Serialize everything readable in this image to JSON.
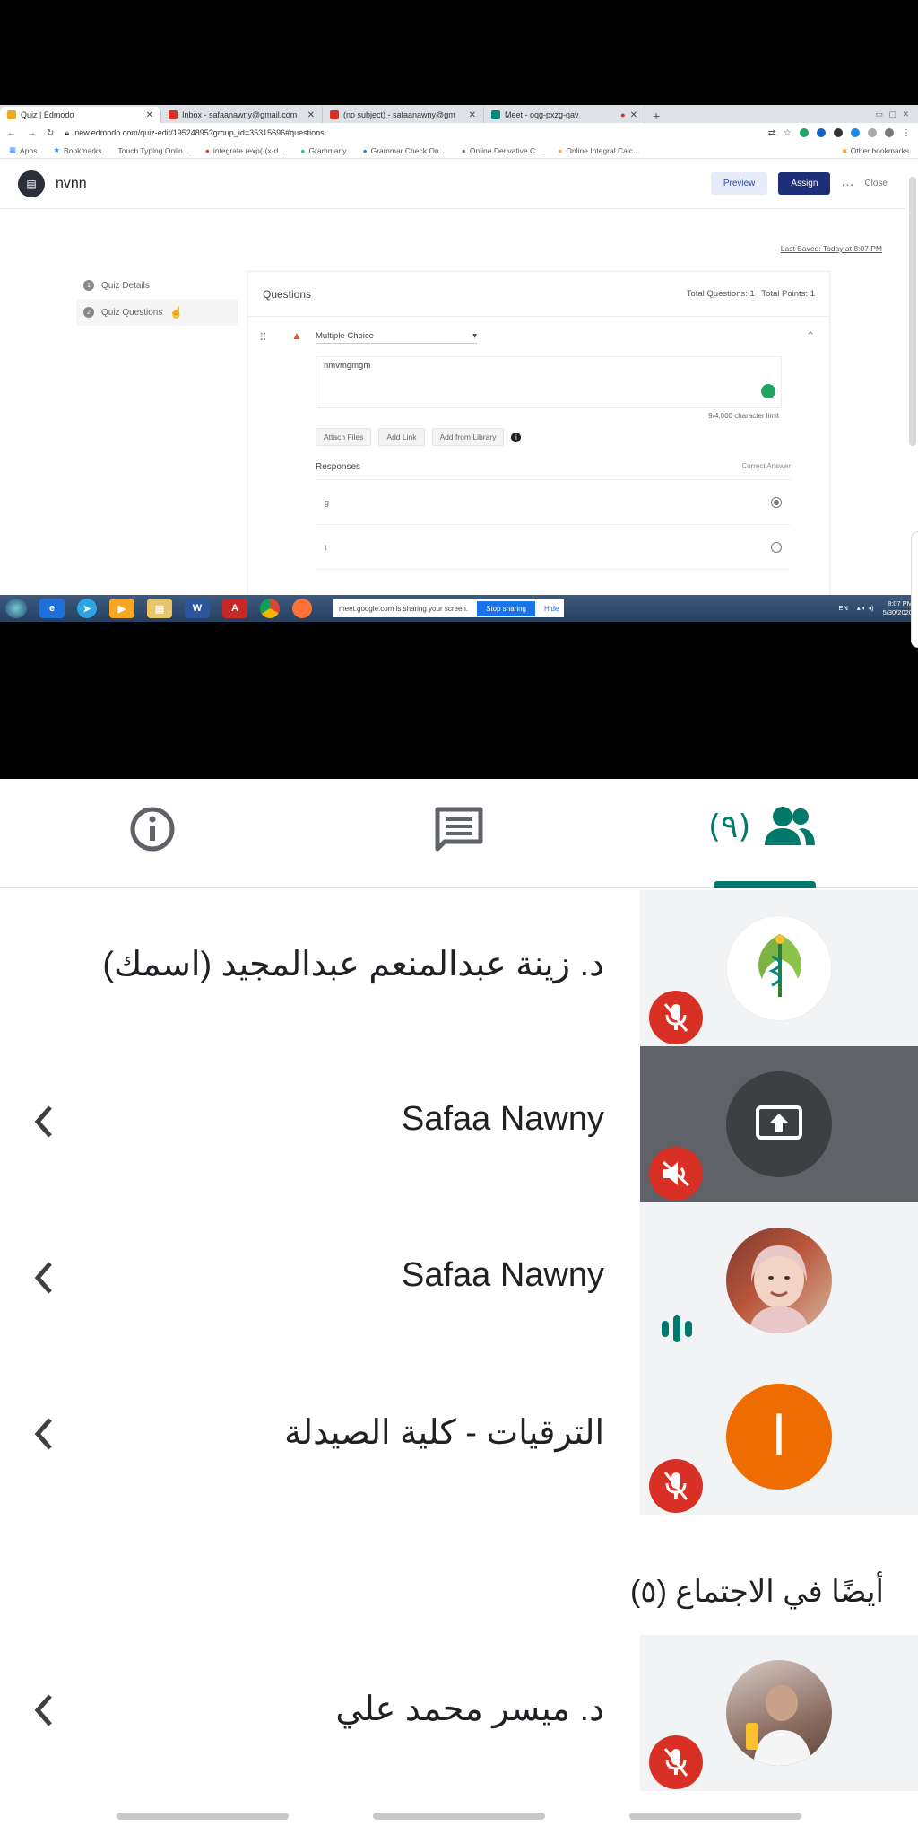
{
  "browser": {
    "tabs": [
      {
        "label": "Quiz | Edmodo",
        "color": "#f5a623",
        "active": true
      },
      {
        "label": "Inbox - safaanawny@gmail.com",
        "color": "#d93025",
        "active": false
      },
      {
        "label": "(no subject) - safaanawny@gm",
        "color": "#d93025",
        "active": false
      },
      {
        "label": "Meet - oqg-pxzg-qav",
        "color": "#00897b",
        "active": false
      }
    ],
    "url": "new.edmodo.com/quiz-edit/19524895?group_id=35315696#questions",
    "bookmarks": [
      "Apps",
      "Bookmarks",
      "Touch Typing Onlin...",
      "integrate (exp(-(x-d...",
      "Grammarly",
      "Grammar Check On...",
      "Online Derivative C...",
      "Online Integral Calc..."
    ],
    "other_bookmarks": "Other bookmarks"
  },
  "edmodo": {
    "quiz_name": "nvnn",
    "preview": "Preview",
    "assign": "Assign",
    "more": "···",
    "close": "Close",
    "last_saved": "Last Saved: Today at 8:07 PM",
    "sidebar": [
      {
        "num": "1",
        "label": "Quiz Details"
      },
      {
        "num": "2",
        "label": "Quiz Questions"
      }
    ],
    "questions_title": "Questions",
    "totals": "Total Questions: 1  |  Total Points: 1",
    "question_type": "Multiple Choice",
    "question_text": "nmvmgmgm",
    "char_limit": "9/4,000 character limit",
    "attach_buttons": [
      "Attach Files",
      "Add Link",
      "Add from Library"
    ],
    "responses": "Responses",
    "correct_answer": "Correct Answer",
    "answers": [
      {
        "text": "g",
        "selected": true
      },
      {
        "text": "t",
        "selected": false
      }
    ]
  },
  "taskbar": {
    "share_text": "meet.google.com is sharing your screen.",
    "stop_sharing": "Stop sharing",
    "hide": "Hide",
    "lang": "EN",
    "time": "8:07 PM",
    "date": "5/30/2020"
  },
  "meet": {
    "people_count": "(٩)",
    "participants": [
      {
        "name": "د. زينة عبدالمنعم عبدالمجيد (اسمك)",
        "avatar": "green-health-logo",
        "state": "muted",
        "chevron": false
      },
      {
        "name": "Safaa Nawny",
        "avatar": "screen-share",
        "state": "muted-audio",
        "chevron": true
      },
      {
        "name": "Safaa Nawny",
        "avatar": "photo",
        "state": "speaking",
        "chevron": true
      },
      {
        "name": "الترقيات - كلية الصيدلة",
        "avatar": "letter",
        "avatar_letter": "ا",
        "avatar_color": "#ef6c00",
        "state": "muted",
        "chevron": true
      }
    ],
    "also_in_meeting": "أيضًا في الاجتماع (٥)",
    "others": [
      {
        "name": "د. ميسر محمد علي",
        "avatar": "photo",
        "state": "muted",
        "chevron": true
      }
    ],
    "accent": "#00796b",
    "mute_color": "#d93025"
  }
}
